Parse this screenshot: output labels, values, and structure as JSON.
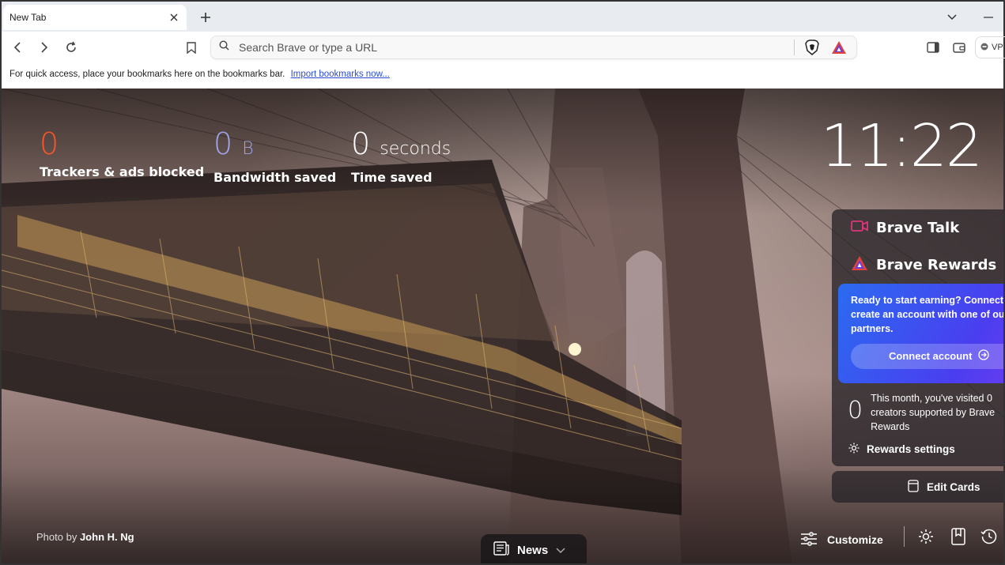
{
  "tabs": [
    {
      "title": "New Tab"
    }
  ],
  "omnibox": {
    "placeholder": "Search Brave or type a URL"
  },
  "toolbar": {
    "vpn_label": "VPN"
  },
  "bookmarks_bar": {
    "message": "For quick access, place your bookmarks here on the bookmarks bar.",
    "import_link": "Import bookmarks now..."
  },
  "stats": {
    "trackers": {
      "value": "0",
      "label": "Trackers & ads blocked",
      "color": "#fb542b"
    },
    "bandwidth": {
      "value": "0",
      "unit": "B",
      "label": "Bandwidth saved",
      "color": "#a0a5eb"
    },
    "time": {
      "value": "0",
      "unit": "seconds",
      "label": "Time saved",
      "color": "#ffffff"
    }
  },
  "clock": "11:22",
  "brave_talk": {
    "title": "Brave Talk"
  },
  "brave_rewards": {
    "title": "Brave Rewards",
    "connect_text": "Ready to start earning? Connect or create an account with one of our partners.",
    "connect_button": "Connect account",
    "visited_count": "0",
    "visited_text": "This month, you've visited 0 creators supported by Brave Rewards",
    "settings_label": "Rewards settings"
  },
  "edit_cards": "Edit Cards",
  "photo_credit": {
    "prefix": "Photo by",
    "author": "John H. Ng"
  },
  "news": {
    "label": "News"
  },
  "customize": {
    "label": "Customize"
  },
  "colors": {
    "brave_orange": "#fb542b",
    "rewards_blue": "#2b6bf0",
    "talk_pink": "#e0357c"
  }
}
